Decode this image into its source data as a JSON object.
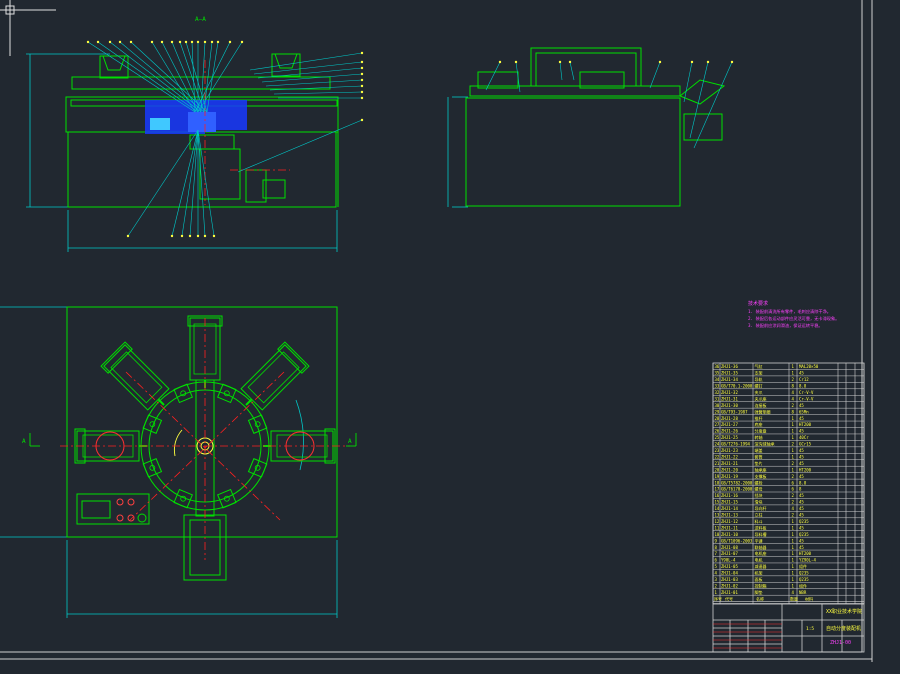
{
  "drawing": {
    "section_label": "A—A",
    "section_marker": "A"
  },
  "notes": {
    "heading": "技术要求",
    "lines": [
      "1. 装配前清洗所有零件，毛刺应清除干净。",
      "2. 装配后各运动部件应灵活可靠，无卡滞现象。",
      "3. 装配前应涂润滑油，保证运转平稳。"
    ]
  },
  "parts_table": {
    "rows": [
      [
        "36",
        "ZHJ1-36",
        "气缸",
        "1",
        "MAL20×50"
      ],
      [
        "35",
        "ZHJ1-35",
        "支架",
        "1",
        "45"
      ],
      [
        "34",
        "ZHJ1-34",
        "导轨",
        "2",
        "Cr12"
      ],
      [
        "33",
        "GB/T70.1-2000",
        "螺钉",
        "8",
        "8.8"
      ],
      [
        "32",
        "ZHJ1-32",
        "夹爪",
        "4",
        "Cr-V-V"
      ],
      [
        "31",
        "ZHJ1-31",
        "夹爪座",
        "4",
        "Cr-V-V"
      ],
      [
        "30",
        "ZHJ1-30",
        "连接板",
        "2",
        "45"
      ],
      [
        "29",
        "GB/T93-1987",
        "弹簧垫圈",
        "8",
        "65Mn"
      ],
      [
        "28",
        "ZHJ1-28",
        "推杆",
        "1",
        "45"
      ],
      [
        "27",
        "ZHJ1-27",
        "底座",
        "1",
        "HT200"
      ],
      [
        "26",
        "ZHJ1-26",
        "分度盘",
        "1",
        "45"
      ],
      [
        "25",
        "ZHJ1-25",
        "转轴",
        "1",
        "40Cr"
      ],
      [
        "24",
        "GB/T276-1994",
        "深沟球轴承",
        "2",
        "GCr15"
      ],
      [
        "23",
        "ZHJ1-23",
        "端盖",
        "1",
        "45"
      ],
      [
        "22",
        "ZHJ1-22",
        "套筒",
        "1",
        "45"
      ],
      [
        "21",
        "ZHJ1-21",
        "垫片",
        "2",
        "45"
      ],
      [
        "20",
        "ZHJ1-20",
        "轴承座",
        "1",
        "HT200"
      ],
      [
        "19",
        "ZHJ1-19",
        "支撑板",
        "2",
        "45"
      ],
      [
        "18",
        "GB/T5782-2000",
        "螺栓",
        "6",
        "8.8"
      ],
      [
        "17",
        "GB/T6170-2000",
        "螺母",
        "6",
        "8"
      ],
      [
        "16",
        "ZHJ1-16",
        "挡块",
        "2",
        "45"
      ],
      [
        "15",
        "ZHJ1-15",
        "滑块",
        "2",
        "45"
      ],
      [
        "14",
        "ZHJ1-14",
        "导向杆",
        "4",
        "45"
      ],
      [
        "13",
        "ZHJ1-13",
        "立柱",
        "2",
        "45"
      ],
      [
        "12",
        "ZHJ1-12",
        "料斗",
        "1",
        "Q235"
      ],
      [
        "11",
        "ZHJ1-11",
        "送料板",
        "1",
        "45"
      ],
      [
        "10",
        "ZHJ1-10",
        "导料槽",
        "1",
        "Q235"
      ],
      [
        "9",
        "GB/T1096-2003",
        "平键",
        "1",
        "45"
      ],
      [
        "8",
        "ZHJ1-08",
        "联轴器",
        "1",
        "45"
      ],
      [
        "7",
        "ZHJ1-07",
        "电机座",
        "1",
        "HT200"
      ],
      [
        "6",
        "Y90L-4",
        "电机",
        "1",
        "YZ90L-4"
      ],
      [
        "5",
        "ZHJ1-05",
        "减速器",
        "1",
        "组件"
      ],
      [
        "4",
        "ZHJ1-04",
        "机架",
        "1",
        "Q235"
      ],
      [
        "3",
        "ZHJ1-03",
        "面板",
        "1",
        "Q235"
      ],
      [
        "2",
        "ZHJ1-02",
        "控制箱",
        "1",
        "组件"
      ],
      [
        "1",
        "ZHJ1-01",
        "脚垫",
        "4",
        "NBR"
      ]
    ],
    "header": [
      "序号",
      "代号",
      "名称",
      "数量",
      "材料"
    ]
  },
  "title_block": {
    "school": "XX职业技术学院",
    "drawing_name": "自动分度装配机",
    "drawing_no": "ZHJ1-00",
    "scale": "1:5"
  },
  "colors": {
    "background": "#212830",
    "outline": "#00e000",
    "dim": "#00c8c8",
    "center": "#ff2020",
    "text": "#ffff40",
    "notes": "#ff40ff",
    "frame": "#d0d0d0",
    "hatch": "#1838ff"
  }
}
